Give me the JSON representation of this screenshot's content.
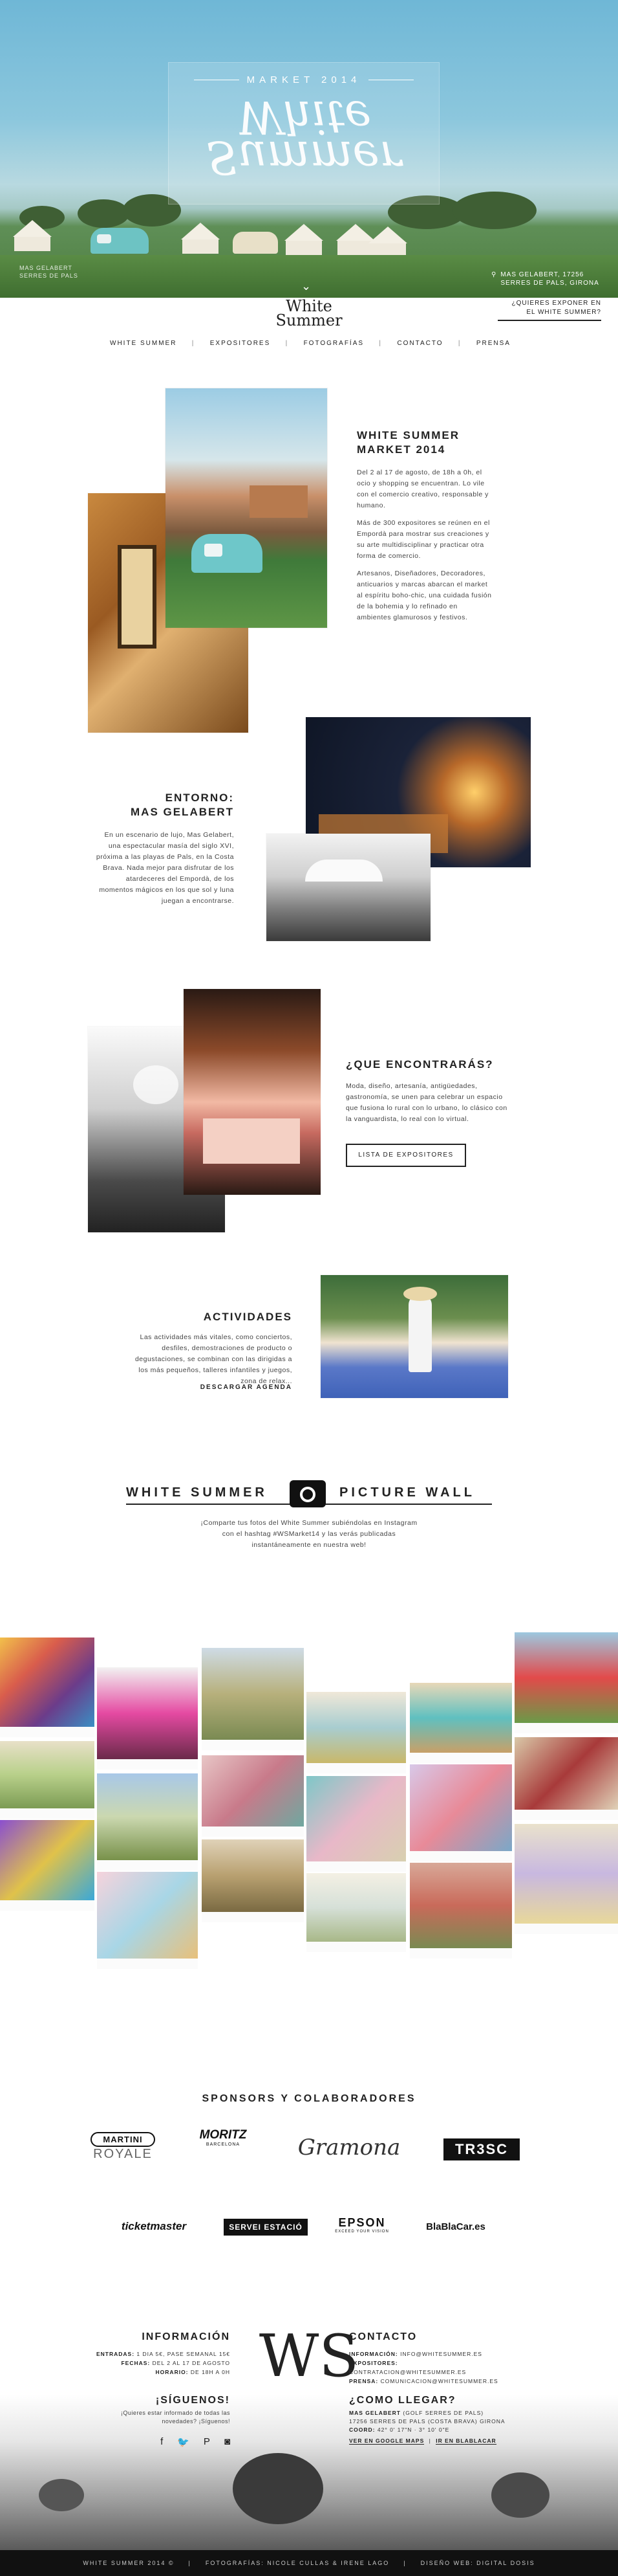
{
  "hero": {
    "market_label": "MARKET 2014",
    "logo_line1": "White",
    "logo_line2": "Summer",
    "location_line1": "MAS GELABERT, 17256",
    "location_line2": "SERRES DE PALS, GIRONA",
    "location_left_line1": "MAS GELABERT",
    "location_left_line2": "SERRES DE PALS"
  },
  "header": {
    "logo_line1": "White",
    "logo_line2": "Summer",
    "expo_line1": "¿QUIERES EXPONER EN",
    "expo_line2": "EL WHITE SUMMER?",
    "nav": [
      "WHITE SUMMER",
      "EXPOSITORES",
      "FOTOGRAFÍAS",
      "CONTACTO",
      "PRENSA"
    ],
    "separator": "|"
  },
  "intro": {
    "title_line1": "WHITE SUMMER",
    "title_line2": "MARKET 2014",
    "p1": "Del 2 al 17 de agosto, de 18h a 0h, el ocio y shopping se encuentran. Lo vile con el comercio creativo, responsable y humano.",
    "p2": "Más de 300 expositores se reúnen en el Empordà para mostrar sus creaciones y su arte multidisciplinar y practicar otra forma de comercio.",
    "p3": "Artesanos, Diseñadores, Decoradores, anticuarios y marcas abarcan el market al espíritu boho-chic, una cuidada fusión de la bohemia y lo refinado en ambientes glamurosos y festivos."
  },
  "entorno": {
    "title_line1": "ENTORNO:",
    "title_line2": "MAS GELABERT",
    "text": "En un escenario de lujo, Mas Gelabert, una espectacular masía del siglo XVI, próxima a las playas de Pals, en la Costa Brava. Nada mejor para disfrutar de los atardeceres del Empordà, de los momentos mágicos en los que sol y luna juegan a encontrarse."
  },
  "encontraras": {
    "title": "¿QUE ENCONTRARÁS?",
    "text": "Moda, diseño, artesanía, antigüedades, gastronomía, se unen para celebrar un espacio que fusiona lo rural con lo urbano, lo clásico con la vanguardista, lo real con lo virtual.",
    "button": "LISTA DE EXPOSITORES"
  },
  "actividades": {
    "title": "ACTIVIDADES",
    "text": "Las actividades más vitales, como conciertos, desfiles, demostraciones de producto o degustaciones, se combinan con las dirigidas a los más pequeños, talleres infantiles y juegos, zona de relax...",
    "link": "DESCARGAR AGENDA"
  },
  "wall": {
    "title_left": "WHITE SUMMER",
    "title_right": "PICTURE WALL",
    "text": "¡Comparte tus fotos del White Summer subiéndolas en Instagram con el hashtag #WSMarket14 y las verás publicadas instantáneamente en nuestra web!"
  },
  "sponsors": {
    "title": "SPONSORS Y COLABORADORES",
    "items": [
      "MARTINI",
      "ROYALE",
      "MORITZ",
      "BARCELONA",
      "Gramona",
      "TR3SC",
      "ticketmaster",
      "SERVEI ESTACIÓ",
      "EPSON",
      "EXCEED YOUR VISION",
      "BlaBlaCar.es"
    ]
  },
  "info": {
    "title": "INFORMACIÓN",
    "rows": [
      {
        "k": "ENTRADAS:",
        "v": "1 DIA 5€, PASE SEMANAL 15€"
      },
      {
        "k": "FECHAS:",
        "v": "DEL 2 AL 17 DE AGOSTO"
      },
      {
        "k": "HORARIO:",
        "v": "DE 18H A 0H"
      }
    ],
    "social_title": "¡SÍGUENOS!",
    "social_text": "¡Quieres estar informado de todas las novedades? ¡Síguenos!",
    "monogram": "WS"
  },
  "contacto": {
    "title": "CONTACTO",
    "rows": [
      {
        "k": "INFORMACIÓN:",
        "v": "INFO@WHITESUMMER.ES"
      },
      {
        "k": "EXPOSITORES:",
        "v": "CONTRATACION@WHITESUMMER.ES"
      },
      {
        "k": "PRENSA:",
        "v": "COMUNICACION@WHITESUMMER.ES"
      }
    ],
    "llegar_title": "¿COMO LLEGAR?",
    "llegar_rows": [
      {
        "k": "MAS GELABERT",
        "v": "(GOLF SERRES DE PALS)"
      },
      {
        "k": "",
        "v": "17256 SERRES DE PALS (COSTA BRAVA) GIRONA"
      },
      {
        "k": "COORD:",
        "v": "42° 0' 17\"N · 3° 10' 0\"E"
      }
    ],
    "maps_link": "VER EN GOOGLE MAPS",
    "bla_link": "IR EN BLABLACAR"
  },
  "footer": {
    "items": [
      "WHITE SUMMER 2014 ©",
      "|",
      "FOTOGRAFÍAS: NICOLE CULLAS & IRENE LAGO",
      "|",
      "DISEÑO WEB: DIGITAL DOSIS"
    ]
  },
  "colors": {
    "accent": "#222222",
    "sky": "#8cc7dd",
    "grass": "#4d7d3f"
  }
}
